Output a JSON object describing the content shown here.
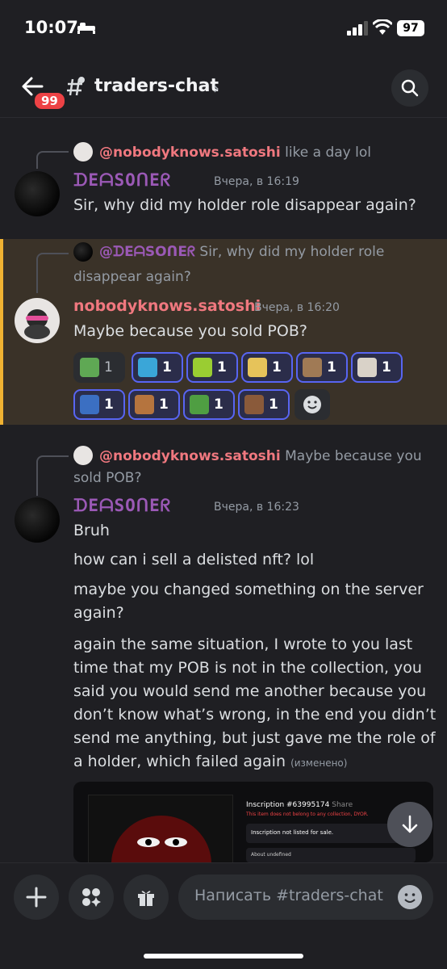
{
  "status_bar": {
    "time": "10:07",
    "battery": "97"
  },
  "header": {
    "back_badge": "99",
    "channel": "traders-chat",
    "chevron": "›"
  },
  "messages": [
    {
      "reply_user": "@nobodyknows.satoshi",
      "reply_text": "like a day lol",
      "author": "ᗪEᗩSOᑎEᖇ",
      "timestamp": "Вчера, в 16:19",
      "lines": [
        "Sir, why did my holder role disappear again?"
      ]
    },
    {
      "reply_user": "@ᗪEᗩSOᑎEᖇ",
      "reply_text_1": "Sir, why did my holder role",
      "reply_text_2": "disappear again?",
      "author": "nobodyknows.satoshi",
      "timestamp": "Вчера, в 16:20",
      "lines": [
        "Maybe because you sold POB?"
      ],
      "reactions": [
        {
          "emoji": "frog-emoji",
          "count": "1",
          "color": "#5fa854"
        },
        {
          "emoji": "pepe-cup-emoji",
          "count": "1",
          "color": "#3aa6d8"
        },
        {
          "emoji": "green-cube-emoji",
          "count": "1",
          "color": "#9acd32"
        },
        {
          "emoji": "doge-emoji",
          "count": "1",
          "color": "#e6c35a"
        },
        {
          "emoji": "cat-emoji",
          "count": "1",
          "color": "#a07a55"
        },
        {
          "emoji": "white-cat-emoji",
          "count": "1",
          "color": "#d9d2c8"
        },
        {
          "emoji": "blue-frog-emoji",
          "count": "1",
          "color": "#3b6fc2"
        },
        {
          "emoji": "monkey-emoji",
          "count": "1",
          "color": "#b5743e"
        },
        {
          "emoji": "pepe-emoji",
          "count": "1",
          "color": "#4f9e42"
        },
        {
          "emoji": "face-emoji",
          "count": "1",
          "color": "#8a5a3a"
        }
      ]
    },
    {
      "reply_user": "@nobodyknows.satoshi",
      "reply_text_1": "Maybe because you",
      "reply_text_2": "sold POB?",
      "author": "ᗪEᗩSOᑎEᖇ",
      "timestamp": "Вчера, в 16:23",
      "lines": [
        "Bruh",
        "how can i sell a delisted nft? lol",
        "maybe you changed something on the server",
        "again?",
        "again the same situation, I wrote to you last",
        "time that my POB is not in the collection, you",
        "said you would send me another because you",
        "don’t know what’s wrong, in the end you didn’t",
        "send me anything, but just gave me the role of",
        "a holder, which failed again"
      ],
      "edited": "(изменено)",
      "embed": {
        "title": "Inscription #63995174",
        "share": "Share",
        "warning": "This item does not belong to any collection, DYOR.",
        "status": "Inscription not listed for sale.",
        "about": "About undefined"
      }
    }
  ],
  "composer": {
    "placeholder": "Написать #traders-chat"
  }
}
